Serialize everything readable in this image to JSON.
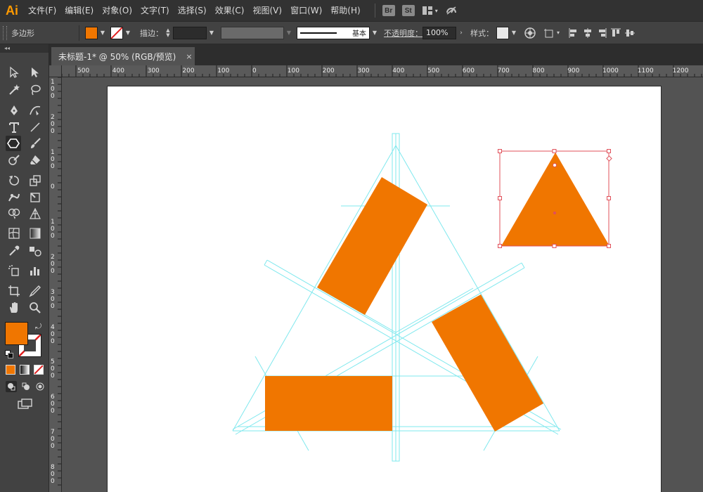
{
  "app": {
    "logo": "Ai"
  },
  "menu": {
    "items": [
      "文件(F)",
      "编辑(E)",
      "对象(O)",
      "文字(T)",
      "选择(S)",
      "效果(C)",
      "视图(V)",
      "窗口(W)",
      "帮助(H)"
    ],
    "bridge_label": "Br",
    "stock_label": "St"
  },
  "control_bar": {
    "selection_label": "多边形",
    "stroke_label": "描边：",
    "stroke_profile_label": "基本",
    "opacity_label": "不透明度：",
    "opacity_value": "100%",
    "style_label": "样式：",
    "fill_color": "#f07600",
    "grip_icon": "panel-grip-icon"
  },
  "document": {
    "tab_title": "未标题-1* @ 50% (RGB/预览)",
    "close_glyph": "×"
  },
  "tools_panel": {
    "collapse_glyph": "◂◂",
    "fill_color": "#f07600",
    "stroke_color": "none"
  },
  "rulers": {
    "horizontal_ticks": [
      "500",
      "400",
      "300",
      "200",
      "100",
      "0",
      "100",
      "200",
      "300",
      "400",
      "500",
      "600",
      "700",
      "800",
      "900",
      "1000",
      "1100",
      "1200"
    ],
    "vertical_ticks": [
      "1 0 0",
      "2 0 0",
      "1 0 0",
      "0",
      "1 0 0",
      "2 0 0",
      "3 0 0",
      "4 0 0",
      "5 0 0",
      "6 0 0",
      "7 0 0",
      "8 0 0"
    ]
  },
  "colors": {
    "accent_orange": "#f07600",
    "guide_cyan": "#7fe8ee",
    "selection_red": "#e0505a",
    "artboard": "#ffffff",
    "workspace": "#535353"
  }
}
